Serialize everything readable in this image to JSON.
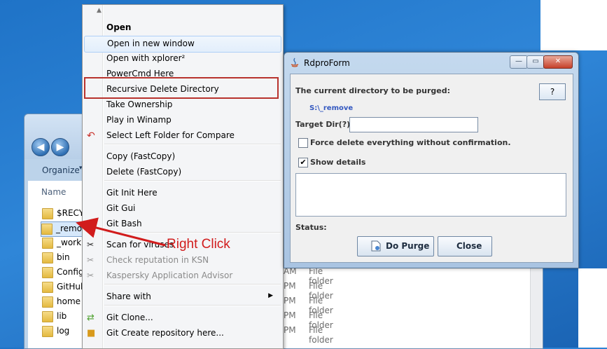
{
  "context_menu": {
    "items": [
      {
        "label": "Open",
        "bold": true
      },
      {
        "label": "Open in new window",
        "hover": true
      },
      {
        "label": "Open with xplorer²"
      },
      {
        "label": "PowerCmd Here"
      },
      {
        "label": "Recursive Delete Directory",
        "highlighted": true
      },
      {
        "label": "Take Ownership"
      },
      {
        "label": "Play in Winamp"
      },
      {
        "label": "Select Left Folder for Compare",
        "icon": "compare-icon"
      },
      {
        "label": "Copy  (FastCopy)"
      },
      {
        "label": "Delete (FastCopy)"
      },
      {
        "label": "Git Init Here"
      },
      {
        "label": "Git Gui"
      },
      {
        "label": "Git Bash"
      },
      {
        "label": "Scan for viruses",
        "icon": "kaspersky-icon"
      },
      {
        "label": "Check reputation in KSN",
        "disabled": true,
        "icon": "kaspersky-icon"
      },
      {
        "label": "Kaspersky Application Advisor",
        "disabled": true,
        "icon": "kaspersky-icon"
      },
      {
        "label": "Share with",
        "submenu": true
      },
      {
        "label": "Git Clone...",
        "icon": "git-clone-icon"
      },
      {
        "label": "Git Create repository here...",
        "icon": "git-create-icon"
      }
    ]
  },
  "annotation": {
    "label": "Right Click",
    "color": "#d11c1c"
  },
  "explorer": {
    "organize_label": "Organize",
    "column_name": "Name",
    "folders": [
      "$RECYC",
      "_remo",
      "_work",
      "bin",
      "Config",
      "GitHub",
      "home",
      "lib",
      "log"
    ],
    "selected_folder": "_remo",
    "right_rows": [
      {
        "time": "AM",
        "kind": "File folder"
      },
      {
        "time": "PM",
        "kind": "File folder"
      },
      {
        "time": "PM",
        "kind": "File folder"
      },
      {
        "time": "PM",
        "kind": "File folder"
      },
      {
        "time": "PM",
        "kind": "File folder"
      }
    ]
  },
  "dialog": {
    "title": "RdproForm",
    "current_dir_label": "The current directory to be purged:",
    "current_dir_value": "S:\\_remove",
    "help_label": "?",
    "target_dir_label": "Target Dir(?):",
    "target_dir_value": "",
    "force_delete_label": "Force delete everything without confirmation.",
    "force_delete_checked": false,
    "show_details_label": "Show details",
    "show_details_checked": true,
    "status_label": "Status:",
    "purge_button": "Do Purge",
    "close_button": "Close"
  },
  "colors": {
    "highlight_box": "#b8332e",
    "link_blue": "#3358c0",
    "desktop": "#2f86d8"
  }
}
